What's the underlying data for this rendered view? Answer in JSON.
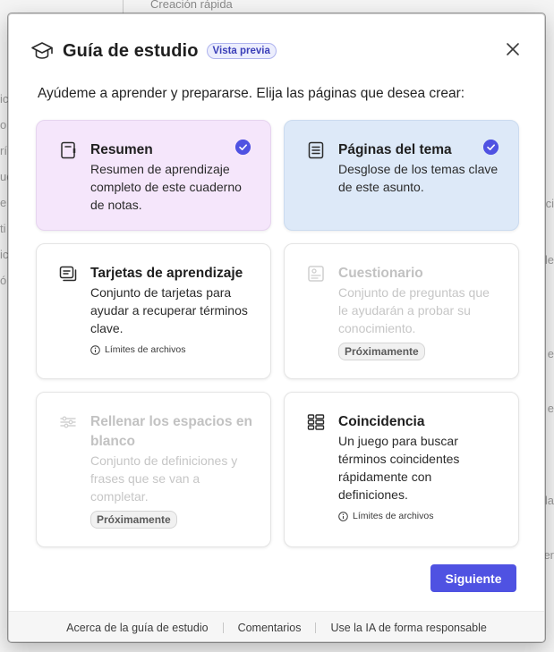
{
  "background": {
    "top_label": "Creación rápida",
    "left_fragments": [
      "ic",
      "o",
      "rí",
      "uc",
      "e",
      "ti",
      "ic",
      "ó"
    ],
    "right_fragments": [
      "ci",
      "le",
      "e",
      "e",
      "la",
      "er"
    ]
  },
  "dialog": {
    "title": "Guía de estudio",
    "badge": "Vista previa",
    "subtitle": "Ayúdeme a aprender y prepararse. Elija las páginas que desea crear:",
    "close_icon": "close-icon",
    "header_icon": "graduation-cap-icon"
  },
  "cards": {
    "resumen": {
      "title": "Resumen",
      "description": "Resumen de aprendizaje completo de este cuaderno de notas.",
      "selected": true,
      "icon": "notebook-icon"
    },
    "paginas": {
      "title": "Páginas del tema",
      "description": "Desglose de los temas clave de este asunto.",
      "selected": true,
      "icon": "document-lines-icon"
    },
    "tarjetas": {
      "title": "Tarjetas de aprendizaje",
      "description": "Conjunto de tarjetas para ayudar a recuperar términos clave.",
      "meta": "Límites de archivos",
      "icon": "flashcards-icon"
    },
    "cuestionario": {
      "title": "Cuestionario",
      "description": "Conjunto de preguntas que le ayudarán a probar su conocimiento.",
      "badge": "Próximamente",
      "icon": "quiz-icon",
      "disabled": true
    },
    "rellenar": {
      "title": "Rellenar los espacios en blanco",
      "description": "Conjunto de definiciones y frases que se van a completar.",
      "badge": "Próximamente",
      "icon": "sliders-icon",
      "disabled": true
    },
    "coincidencia": {
      "title": "Coincidencia",
      "description": "Un juego para buscar términos coincidentes rápidamente con definiciones.",
      "meta": "Límites de archivos",
      "icon": "grid-match-icon"
    }
  },
  "actions": {
    "next_label": "Siguiente"
  },
  "footer": {
    "links": [
      "Acerca de la guía de estudio",
      "Comentarios",
      "Use la IA de forma responsable"
    ]
  },
  "colors": {
    "accent": "#4f52e2",
    "selected_purple": "#f5e6fb",
    "selected_blue": "#dde9f8"
  }
}
